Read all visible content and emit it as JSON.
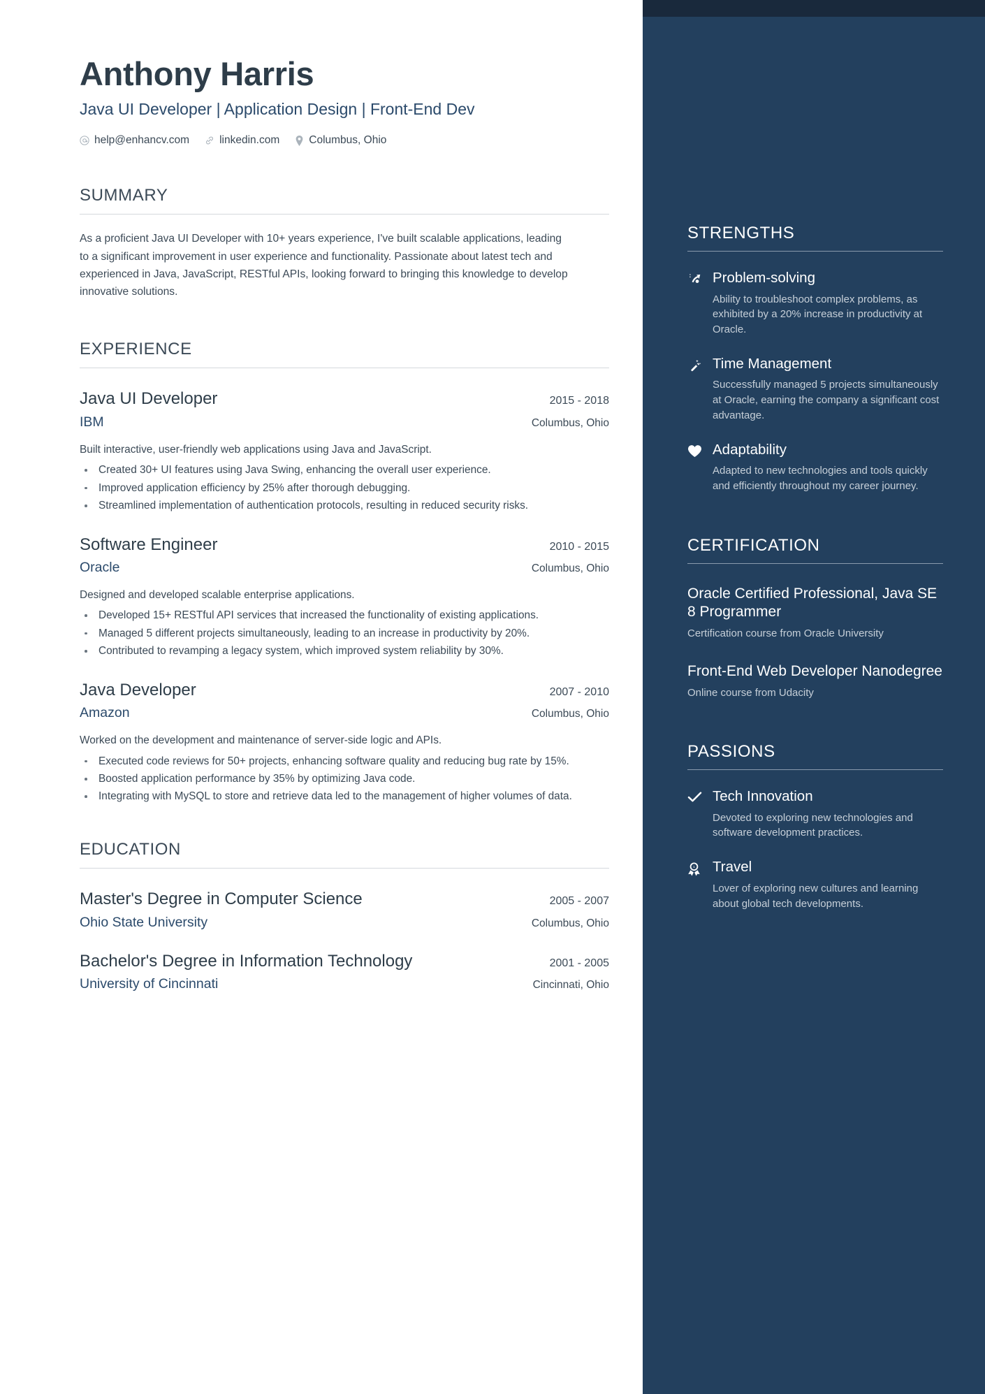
{
  "header": {
    "name": "Anthony Harris",
    "headline": "Java UI Developer | Application Design | Front-End Dev",
    "contacts": [
      {
        "icon": "email-icon",
        "text": "help@enhancv.com"
      },
      {
        "icon": "link-icon",
        "text": "linkedin.com"
      },
      {
        "icon": "location-pin-icon",
        "text": "Columbus, Ohio"
      }
    ]
  },
  "summary": {
    "title": "SUMMARY",
    "text": "As a proficient Java UI Developer with 10+ years experience, I've built scalable applications, leading to a significant improvement in user experience and functionality. Passionate about latest tech and experienced in Java, JavaScript, RESTful APIs, looking forward to bringing this knowledge to develop innovative solutions."
  },
  "experience": {
    "title": "EXPERIENCE",
    "entries": [
      {
        "role": "Java UI Developer",
        "dates": "2015 - 2018",
        "company": "IBM",
        "location": "Columbus, Ohio",
        "description": "Built interactive, user-friendly web applications using Java and JavaScript.",
        "bullets": [
          "Created 30+ UI features using Java Swing, enhancing the overall user experience.",
          "Improved application efficiency by 25% after thorough debugging.",
          "Streamlined implementation of authentication protocols, resulting in reduced security risks."
        ]
      },
      {
        "role": "Software Engineer",
        "dates": "2010 - 2015",
        "company": "Oracle",
        "location": "Columbus, Ohio",
        "description": "Designed and developed scalable enterprise applications.",
        "bullets": [
          "Developed 15+ RESTful API services that increased the functionality of existing applications.",
          "Managed 5 different projects simultaneously, leading to an increase in productivity by 20%.",
          "Contributed to revamping a legacy system, which improved system reliability by 30%."
        ]
      },
      {
        "role": "Java Developer",
        "dates": "2007 - 2010",
        "company": "Amazon",
        "location": "Columbus, Ohio",
        "description": "Worked on the development and maintenance of server-side logic and APIs.",
        "bullets": [
          "Executed code reviews for 50+ projects, enhancing software quality and reducing bug rate by 15%.",
          "Boosted application performance by 35% by optimizing Java code.",
          "Integrating with MySQL to store and retrieve data led to the management of higher volumes of data."
        ]
      }
    ]
  },
  "education": {
    "title": "EDUCATION",
    "entries": [
      {
        "degree": "Master's Degree in Computer Science",
        "dates": "2005 - 2007",
        "school": "Ohio State University",
        "location": "Columbus, Ohio"
      },
      {
        "degree": "Bachelor's Degree in Information Technology",
        "dates": "2001 - 2005",
        "school": "University of Cincinnati",
        "location": "Cincinnati, Ohio"
      }
    ]
  },
  "strengths": {
    "title": "STRENGTHS",
    "items": [
      {
        "icon": "magic-sparkle-arrow-icon",
        "name": "Problem-solving",
        "desc": "Ability to troubleshoot complex problems, as exhibited by a 20% increase in productivity at Oracle."
      },
      {
        "icon": "magic-wand-icon",
        "name": "Time Management",
        "desc": "Successfully managed 5 projects simultaneously at Oracle, earning the company a significant cost advantage."
      },
      {
        "icon": "heart-icon",
        "name": "Adaptability",
        "desc": "Adapted to new technologies and tools quickly and efficiently throughout my career journey."
      }
    ]
  },
  "certification": {
    "title": "CERTIFICATION",
    "items": [
      {
        "name": "Oracle Certified Professional, Java SE 8 Programmer",
        "sub": "Certification course from Oracle University"
      },
      {
        "name": "Front-End Web Developer Nanodegree",
        "sub": "Online course from Udacity"
      }
    ]
  },
  "passions": {
    "title": "PASSIONS",
    "items": [
      {
        "icon": "check-icon",
        "name": "Tech Innovation",
        "desc": "Devoted to exploring new technologies and software development practices."
      },
      {
        "icon": "award-ribbon-icon",
        "name": "Travel",
        "desc": "Lover of exploring new cultures and learning about global tech developments."
      }
    ]
  },
  "colors": {
    "sidebar_bg": "#23405e",
    "sidebar_topbar": "#19293c",
    "accent_blue": "#2b4a6b",
    "text_dark": "#2e3d49",
    "text_body": "#3c4a57"
  }
}
